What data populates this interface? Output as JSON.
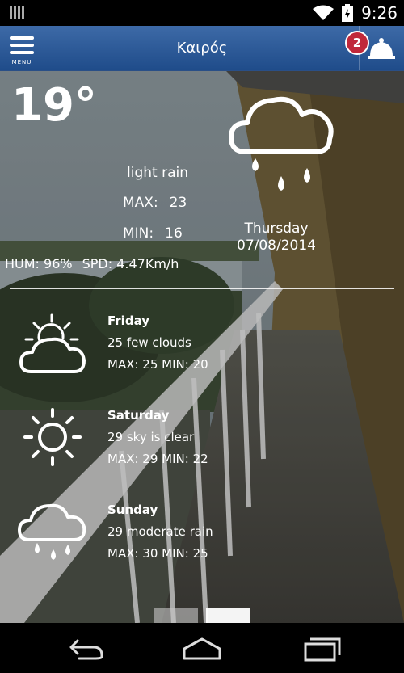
{
  "status_bar": {
    "time": "9:26",
    "icons": [
      "signal-bars-icon",
      "wifi-icon",
      "battery-icon"
    ]
  },
  "app_bar": {
    "title": "Καιρός",
    "menu_label": "MENU",
    "notification_count": "2"
  },
  "current": {
    "temperature": "19°",
    "description": "light rain",
    "max_label": "MAX:",
    "max_value": "23",
    "min_label": "MIN:",
    "min_value": "16",
    "day": "Thursday",
    "date": "07/08/2014",
    "humidity": "HUM: 96%",
    "speed": "SPD: 4.47Km/h",
    "icon": "rain-cloud-icon"
  },
  "forecast": [
    {
      "day": "Friday",
      "description": "25 few clouds",
      "minmax": "MAX: 25 MIN: 20",
      "icon": "partly-cloudy-icon"
    },
    {
      "day": "Saturday",
      "description": "29 sky is clear",
      "minmax": "MAX: 29 MIN: 22",
      "icon": "sun-icon"
    },
    {
      "day": "Sunday",
      "description": "29 moderate rain",
      "minmax": "MAX: 30 MIN: 25",
      "icon": "rain-cloud-icon"
    }
  ],
  "pager": {
    "pages": 2,
    "active": 2
  },
  "nav_bar": [
    "back-icon",
    "home-icon",
    "recents-icon"
  ],
  "colors": {
    "appbar": "#2b5a98",
    "badge": "#c0283a"
  }
}
